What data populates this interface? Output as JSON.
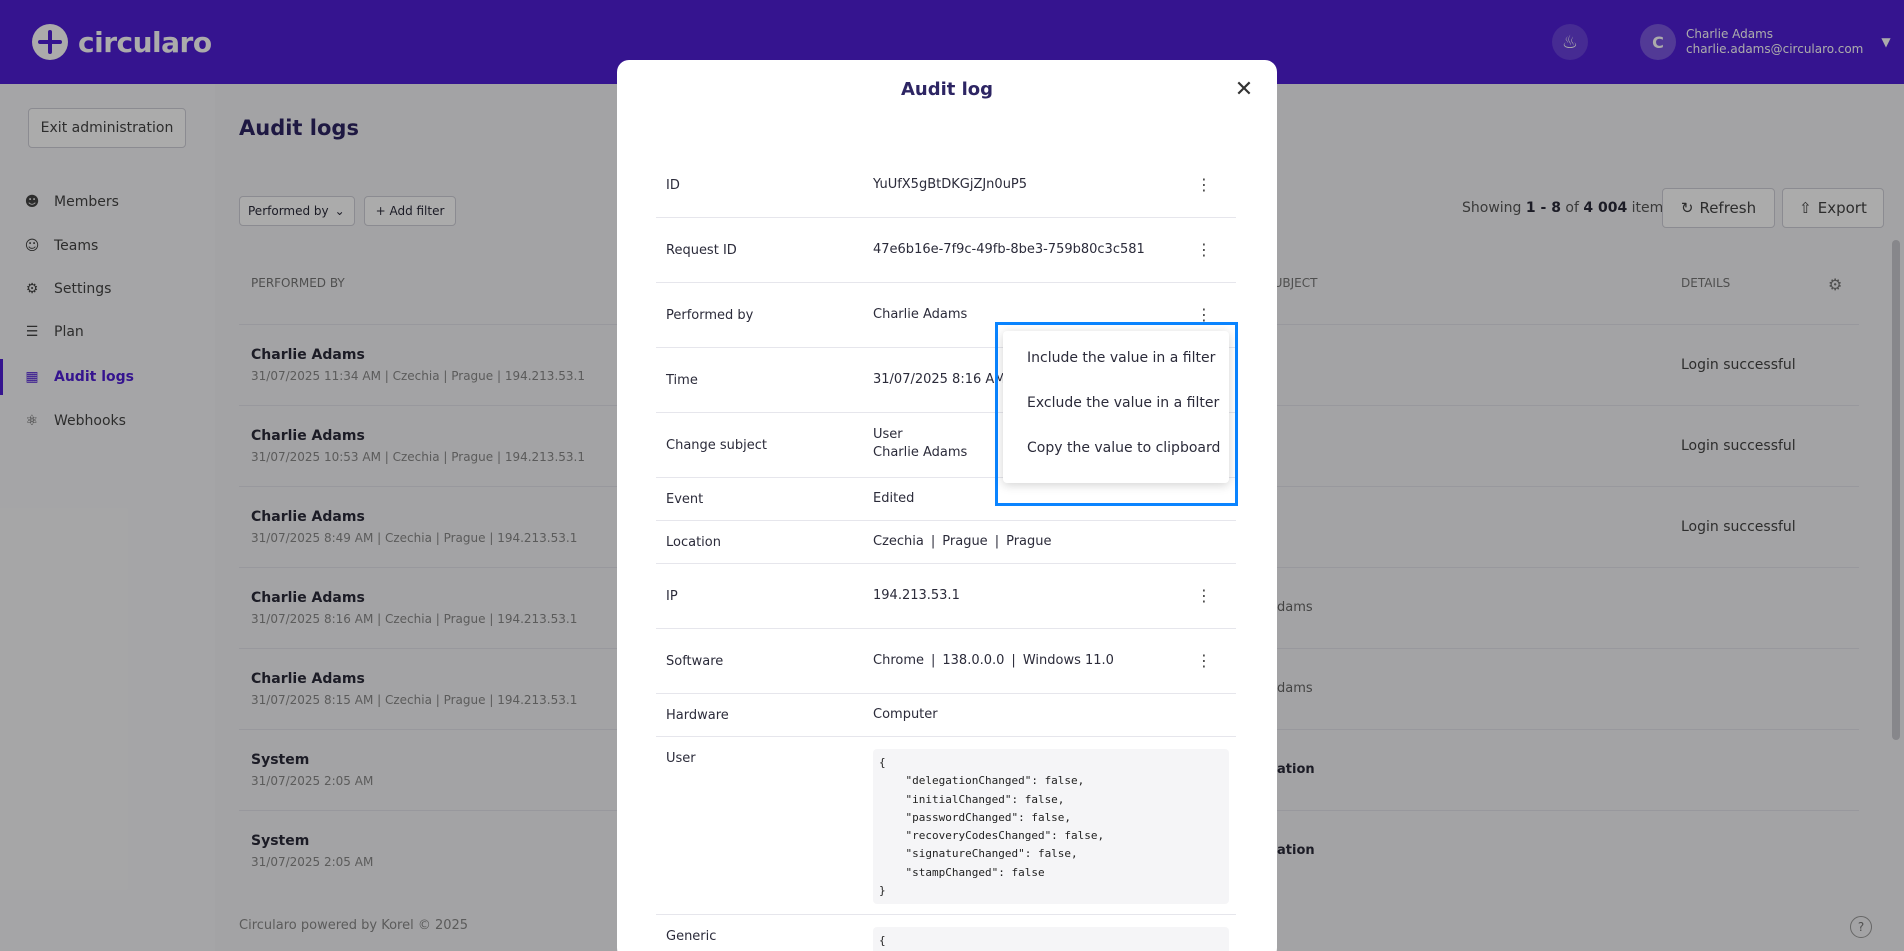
{
  "app": {
    "logo_text": "circularo",
    "user_name": "Charlie Adams",
    "user_email": "charlie.adams@circularo.com",
    "avatar_initial": "C"
  },
  "sidebar": {
    "exit_label": "Exit administration",
    "items": [
      {
        "label": "Members",
        "icon": "person-icon"
      },
      {
        "label": "Teams",
        "icon": "team-icon"
      },
      {
        "label": "Settings",
        "icon": "gear-icon"
      },
      {
        "label": "Plan",
        "icon": "list-icon"
      },
      {
        "label": "Audit logs",
        "icon": "log-icon",
        "active": true
      },
      {
        "label": "Webhooks",
        "icon": "webhook-icon"
      }
    ]
  },
  "main": {
    "title": "Audit logs",
    "filter_label": "Performed by",
    "add_filter_label": "Add filter",
    "showing_prefix": "Showing",
    "showing_range": "1 - 8",
    "showing_of": "of",
    "showing_total": "4 004",
    "showing_suffix": "items",
    "refresh_label": "Refresh",
    "export_label": "Export",
    "columns": {
      "performed_by": "PERFORMED BY",
      "subject": "SUBJECT",
      "details": "DETAILS"
    },
    "rows": [
      {
        "name": "Charlie Adams",
        "meta": "31/07/2025 11:34 AM | Czechia | Prague | 194.213.53.1",
        "subject": "",
        "details": "Login successful"
      },
      {
        "name": "Charlie Adams",
        "meta": "31/07/2025 10:53 AM | Czechia | Prague | 194.213.53.1",
        "subject": "",
        "details": "Login successful"
      },
      {
        "name": "Charlie Adams",
        "meta": "31/07/2025 8:49 AM | Czechia | Prague | 194.213.53.1",
        "subject": "",
        "details": "Login successful"
      },
      {
        "name": "Charlie Adams",
        "meta": "31/07/2025 8:16 AM | Czechia | Prague | 194.213.53.1",
        "subject": "dams",
        "details": ""
      },
      {
        "name": "Charlie Adams",
        "meta": "31/07/2025 8:15 AM | Czechia | Prague | 194.213.53.1",
        "subject": "dams",
        "details": ""
      },
      {
        "name": "System",
        "meta": "31/07/2025 2:05 AM",
        "subject": "ation",
        "details": ""
      },
      {
        "name": "System",
        "meta": "31/07/2025 2:05 AM",
        "subject": "ation",
        "details": ""
      }
    ],
    "footer": "Circularo powered by Korel © 2025"
  },
  "modal": {
    "title": "Audit log",
    "fields": {
      "id": {
        "label": "ID",
        "value": "YuUfX5gBtDKGjZJn0uP5"
      },
      "request_id": {
        "label": "Request ID",
        "value": "47e6b16e-7f9c-49fb-8be3-759b80c3c581"
      },
      "performed_by": {
        "label": "Performed by",
        "value": "Charlie Adams"
      },
      "time": {
        "label": "Time",
        "value": "31/07/2025 8:16 AM"
      },
      "change_subject": {
        "label": "Change subject",
        "value_line1": "User",
        "value_line2": "Charlie Adams"
      },
      "event": {
        "label": "Event",
        "value": "Edited"
      },
      "location": {
        "label": "Location",
        "parts": [
          "Czechia",
          "Prague",
          "Prague"
        ]
      },
      "ip": {
        "label": "IP",
        "value": "194.213.53.1"
      },
      "software": {
        "label": "Software",
        "parts": [
          "Chrome",
          "138.0.0.0",
          "Windows 11.0"
        ]
      },
      "hardware": {
        "label": "Hardware",
        "value": "Computer"
      },
      "user": {
        "label": "User",
        "json": "{\n    \"delegationChanged\": false,\n    \"initialChanged\": false,\n    \"passwordChanged\": false,\n    \"recoveryCodesChanged\": false,\n    \"signatureChanged\": false,\n    \"stampChanged\": false\n}"
      },
      "generic": {
        "label": "Generic",
        "json": "{"
      }
    }
  },
  "context_menu": {
    "items": [
      "Include the value in a filter",
      "Exclude the value in a filter",
      "Copy the value to clipboard"
    ]
  }
}
